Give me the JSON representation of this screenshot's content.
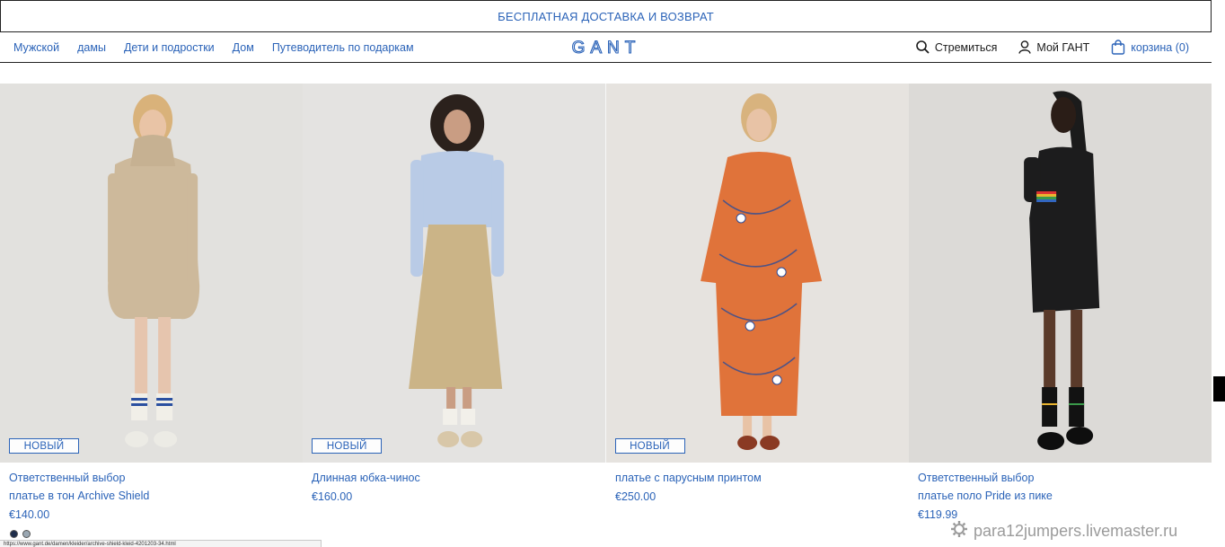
{
  "promo_bar": {
    "text": "БЕСПЛАТНАЯ ДОСТАВКА И ВОЗВРАТ"
  },
  "nav": {
    "links": [
      "Мужской",
      "дамы",
      "Дети и подростки",
      "Дом",
      "Путеводитель по подаркам"
    ],
    "logo": "GANT",
    "search_label": "Стремиться",
    "account_label": "Мой ГАНТ",
    "cart_label": "корзина (0)"
  },
  "products": [
    {
      "badge": "НОВЫЙ",
      "line1": "Ответственный выбор",
      "line2": "платье в тон Archive Shield",
      "price": "€140.00"
    },
    {
      "badge": "НОВЫЙ",
      "line1": "Длинная юбка-чинос",
      "line2": "",
      "price": "€160.00"
    },
    {
      "badge": "НОВЫЙ",
      "line1": "платье с парусным принтом",
      "line2": "",
      "price": "€250.00"
    },
    {
      "badge": "",
      "line1": "Ответственный выбор",
      "line2": "платье поло Pride из пике",
      "price": "€119.99"
    }
  ],
  "status_url": "https://www.gant.de/damen/kleider/archive-shield-kleid-4201203-34.html",
  "watermark": "para12jumpers.livemaster.ru",
  "colors": {
    "brand_blue": "#2b63b8",
    "photo_bg": "#e4e2df"
  },
  "icons": [
    "search-icon",
    "user-icon",
    "bag-icon",
    "gear-icon"
  ]
}
